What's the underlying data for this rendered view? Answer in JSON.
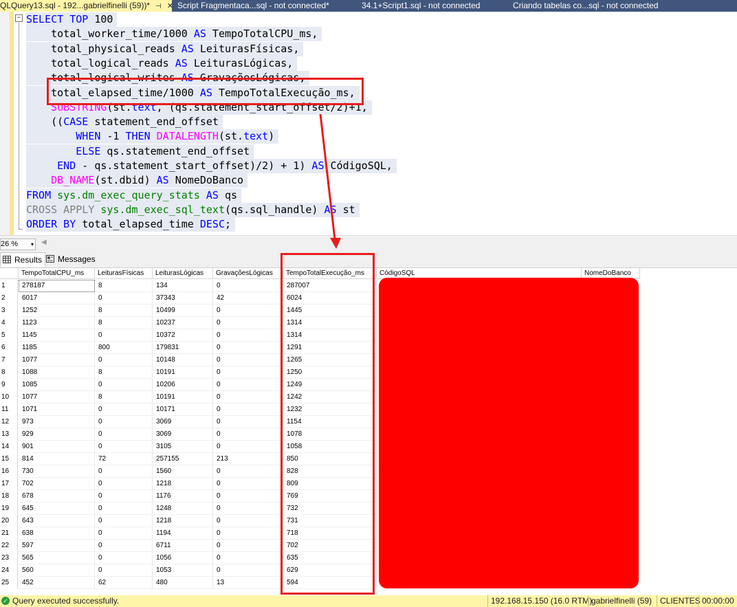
{
  "tabs": [
    {
      "label": "QLQuery13.sql - 192...gabrielfinelli (59))*",
      "pin": "⊣",
      "close": "✕",
      "active": true
    },
    {
      "label": "Script Fragmentaca...sql - not connected*",
      "active": false
    },
    {
      "label": "34.1+Script1.sql - not connected",
      "active": false
    },
    {
      "label": "Criando tabelas co...sql - not connected",
      "active": false
    }
  ],
  "editor": {
    "collapse_glyph": "−",
    "code_lines": [
      [
        {
          "t": "SELECT TOP ",
          "c": "kw"
        },
        {
          "t": "100",
          "c": ""
        }
      ],
      [
        {
          "t": "    total_worker_time/1000 ",
          "c": ""
        },
        {
          "t": "AS",
          "c": "kw"
        },
        {
          "t": " TempoTotalCPU_ms,",
          "c": ""
        }
      ],
      [
        {
          "t": "    total_physical_reads ",
          "c": ""
        },
        {
          "t": "AS",
          "c": "kw"
        },
        {
          "t": " LeiturasFísicas,",
          "c": ""
        }
      ],
      [
        {
          "t": "    total_logical_reads ",
          "c": ""
        },
        {
          "t": "AS",
          "c": "kw"
        },
        {
          "t": " LeiturasLógicas,",
          "c": ""
        }
      ],
      [
        {
          "t": "    total_logical_writes ",
          "c": ""
        },
        {
          "t": "AS",
          "c": "kw"
        },
        {
          "t": " GravaçõesLógicas,",
          "c": ""
        }
      ],
      [
        {
          "t": "    total_elapsed_time/1000 ",
          "c": ""
        },
        {
          "t": "AS",
          "c": "kw"
        },
        {
          "t": " TempoTotalExecução_ms,",
          "c": ""
        }
      ],
      [
        {
          "t": "    ",
          "c": ""
        },
        {
          "t": "SUBSTRING",
          "c": "fn"
        },
        {
          "t": "(st.",
          "c": ""
        },
        {
          "t": "text",
          "c": "kw"
        },
        {
          "t": ", (qs.statement_start_offset/2)+1,",
          "c": ""
        }
      ],
      [
        {
          "t": "    ((",
          "c": ""
        },
        {
          "t": "CASE",
          "c": "kw"
        },
        {
          "t": " statement_end_offset",
          "c": ""
        }
      ],
      [
        {
          "t": "        ",
          "c": ""
        },
        {
          "t": "WHEN",
          "c": "kw"
        },
        {
          "t": " -1 ",
          "c": ""
        },
        {
          "t": "THEN",
          "c": "kw"
        },
        {
          "t": " ",
          "c": ""
        },
        {
          "t": "DATALENGTH",
          "c": "fn"
        },
        {
          "t": "(st.",
          "c": ""
        },
        {
          "t": "text",
          "c": "kw"
        },
        {
          "t": ")",
          "c": ""
        }
      ],
      [
        {
          "t": "        ",
          "c": ""
        },
        {
          "t": "ELSE",
          "c": "kw"
        },
        {
          "t": " qs.statement_end_offset",
          "c": ""
        }
      ],
      [
        {
          "t": "     ",
          "c": ""
        },
        {
          "t": "END",
          "c": "kw"
        },
        {
          "t": " - qs.statement_start_offset)/2) + 1) ",
          "c": ""
        },
        {
          "t": "AS",
          "c": "kw"
        },
        {
          "t": " CódigoSQL,",
          "c": ""
        }
      ],
      [
        {
          "t": "    ",
          "c": ""
        },
        {
          "t": "DB_NAME",
          "c": "fn"
        },
        {
          "t": "(st.dbid) ",
          "c": ""
        },
        {
          "t": "AS",
          "c": "kw"
        },
        {
          "t": " NomeDoBanco",
          "c": ""
        }
      ],
      [
        {
          "t": "FROM ",
          "c": "kw"
        },
        {
          "t": "sys.dm_exec_query_stats",
          "c": "sy"
        },
        {
          "t": " ",
          "c": ""
        },
        {
          "t": "AS",
          "c": "kw"
        },
        {
          "t": " qs",
          "c": ""
        }
      ],
      [
        {
          "t": "CROSS APPLY ",
          "c": "gr"
        },
        {
          "t": "sys.dm_exec_sql_text",
          "c": "sy"
        },
        {
          "t": "(qs.sql_handle) ",
          "c": ""
        },
        {
          "t": "AS",
          "c": "kw"
        },
        {
          "t": " st",
          "c": ""
        }
      ],
      [
        {
          "t": "ORDER BY ",
          "c": "kw"
        },
        {
          "t": "total_elapsed_time ",
          "c": ""
        },
        {
          "t": "DESC",
          "c": "kw"
        },
        {
          "t": ";",
          "c": ""
        }
      ]
    ]
  },
  "zoom": {
    "value": "26 %",
    "chevron": "▾",
    "scroll_arrow": "◀"
  },
  "results_tabs": [
    {
      "label": "Results",
      "icon": "grid-icon",
      "selected": true
    },
    {
      "label": "Messages",
      "icon": "messages-icon",
      "selected": false
    }
  ],
  "grid": {
    "columns": [
      "TempoTotalCPU_ms",
      "LeiturasFísicas",
      "LeiturasLógicas",
      "GravaçõesLógicas",
      "TempoTotalExecução_ms",
      "CódigoSQL",
      "NomeDoBanco"
    ],
    "rows": [
      [
        "1",
        "278187",
        "8",
        "134",
        "0",
        "287007"
      ],
      [
        "2",
        "6017",
        "0",
        "37343",
        "42",
        "6024"
      ],
      [
        "3",
        "1252",
        "8",
        "10499",
        "0",
        "1445"
      ],
      [
        "4",
        "1123",
        "8",
        "10237",
        "0",
        "1314"
      ],
      [
        "5",
        "1145",
        "0",
        "10372",
        "0",
        "1314"
      ],
      [
        "6",
        "1185",
        "800",
        "179831",
        "0",
        "1291"
      ],
      [
        "7",
        "1077",
        "0",
        "10148",
        "0",
        "1265"
      ],
      [
        "8",
        "1088",
        "8",
        "10191",
        "0",
        "1250"
      ],
      [
        "9",
        "1085",
        "0",
        "10206",
        "0",
        "1249"
      ],
      [
        "10",
        "1077",
        "8",
        "10191",
        "0",
        "1242"
      ],
      [
        "11",
        "1071",
        "0",
        "10171",
        "0",
        "1232"
      ],
      [
        "12",
        "973",
        "0",
        "3069",
        "0",
        "1154"
      ],
      [
        "13",
        "929",
        "0",
        "3069",
        "0",
        "1078"
      ],
      [
        "14",
        "901",
        "0",
        "3105",
        "0",
        "1058"
      ],
      [
        "15",
        "814",
        "72",
        "257155",
        "213",
        "850"
      ],
      [
        "16",
        "730",
        "0",
        "1560",
        "0",
        "828"
      ],
      [
        "17",
        "702",
        "0",
        "1218",
        "0",
        "809"
      ],
      [
        "18",
        "678",
        "0",
        "1176",
        "0",
        "769"
      ],
      [
        "19",
        "645",
        "0",
        "1248",
        "0",
        "732"
      ],
      [
        "20",
        "643",
        "0",
        "1218",
        "0",
        "731"
      ],
      [
        "21",
        "638",
        "0",
        "1194",
        "0",
        "718"
      ],
      [
        "22",
        "597",
        "0",
        "6711",
        "0",
        "702"
      ],
      [
        "23",
        "565",
        "0",
        "1056",
        "0",
        "635"
      ],
      [
        "24",
        "560",
        "0",
        "1053",
        "0",
        "629"
      ],
      [
        "25",
        "452",
        "62",
        "480",
        "13",
        "594"
      ]
    ]
  },
  "annotation": {
    "color": "#e81d1d"
  },
  "redaction": {
    "color": "#ff0000"
  },
  "status": {
    "icon": "✓",
    "message": "Query executed successfully.",
    "server": "192.168.15.150 (16.0 RTM)",
    "user": "gabrielfinelli (59)",
    "database": "CLIENTES",
    "elapsed": "00:00:00"
  },
  "colors": {
    "tabbar": "#40567d",
    "active_tab": "#fff5a8",
    "status_bar": "#fff5a8",
    "keyword": "#0000ff",
    "function": "#ff00ff",
    "system_object": "#008000"
  }
}
